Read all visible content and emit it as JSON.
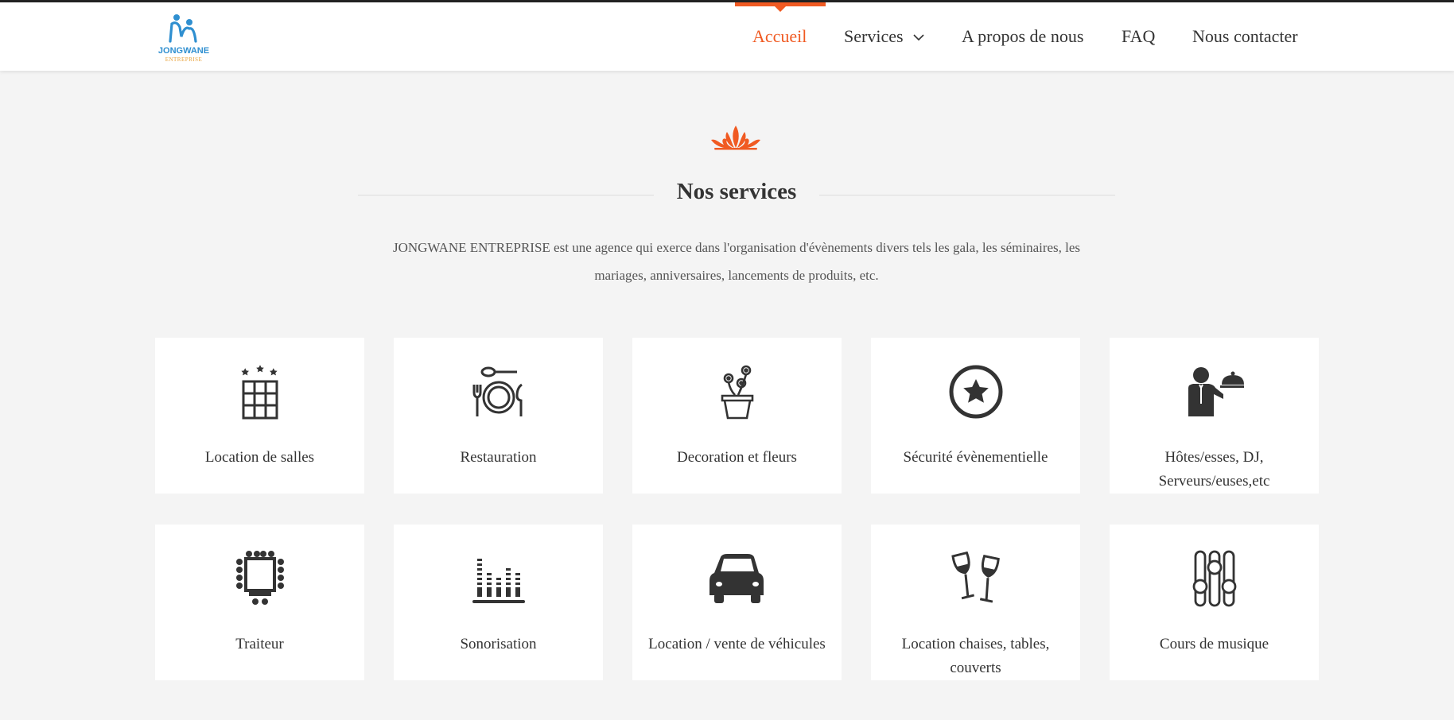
{
  "brand": {
    "name": "JONGWANE",
    "subtitle": "ENTREPRISE",
    "logo_icon": "people-icon",
    "colors": {
      "blue": "#2f8fd0",
      "orange": "#e8a23a"
    }
  },
  "nav": {
    "items": [
      {
        "label": "Accueil",
        "active": true
      },
      {
        "label": "Services",
        "dropdown": true
      },
      {
        "label": "A propos de nous"
      },
      {
        "label": "FAQ"
      },
      {
        "label": "Nous contacter"
      }
    ]
  },
  "section": {
    "title": "Nos services",
    "description_line1": "JONGWANE ENTREPRISE est une agence qui exerce dans l'organisation d'évènements divers tels les gala, les séminaires, les",
    "description_line2": "mariages, anniversaires, lancements de produits, etc."
  },
  "services": [
    {
      "label": "Location de salles",
      "icon": "building-icon"
    },
    {
      "label": "Restauration",
      "icon": "plate-cutlery-icon"
    },
    {
      "label": "Decoration et fleurs",
      "icon": "flower-pot-icon"
    },
    {
      "label": "Sécurité évènementielle",
      "icon": "star-badge-icon"
    },
    {
      "label_line1": "Hôtes/esses, DJ,",
      "label_line2": "Serveurs/euses,etc",
      "icon": "waiter-icon"
    },
    {
      "label": "Traiteur",
      "icon": "banquet-table-icon"
    },
    {
      "label": "Sonorisation",
      "icon": "equalizer-icon"
    },
    {
      "label": "Location / vente de véhicules",
      "icon": "car-icon"
    },
    {
      "label_line1": "Location chaises, tables,",
      "label_line2": "couverts",
      "icon": "wine-glasses-icon"
    },
    {
      "label": "Cours de musique",
      "icon": "sliders-icon"
    }
  ],
  "colors": {
    "accent": "#f05a22",
    "text": "#333333",
    "background": "#f4f4f4"
  }
}
